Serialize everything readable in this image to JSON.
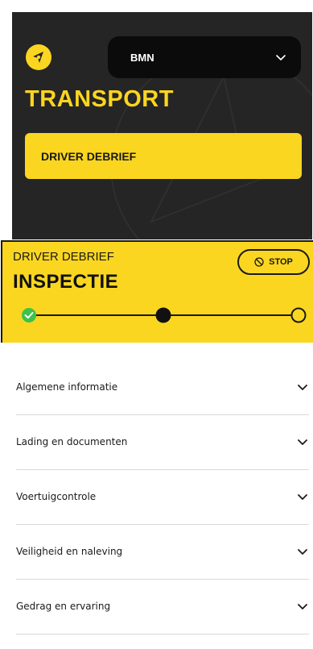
{
  "header": {
    "logo_icon": "compass-arrow-icon",
    "company_select": {
      "value": "BMN",
      "icon": "chevron-down-icon"
    },
    "brand_title": "TRANSPORT",
    "debrief_button_label": "DRIVER DEBRIEF"
  },
  "inspection": {
    "subtitle": "DRIVER DEBRIEF",
    "title": "INSPECTIE",
    "stop_button": {
      "label": "STOP",
      "icon": "prohibited-icon"
    },
    "stepper": {
      "total_steps": 3,
      "completed_steps": 1,
      "current_step": 2
    }
  },
  "sections": [
    {
      "label": "Algemene informatie"
    },
    {
      "label": "Lading en documenten"
    },
    {
      "label": "Voertuigcontrole"
    },
    {
      "label": "Veiligheid en naleving"
    },
    {
      "label": "Gedrag en ervaring"
    }
  ],
  "colors": {
    "accent": "#fbd620",
    "dark": "#252525",
    "check": "#3ec24a"
  }
}
